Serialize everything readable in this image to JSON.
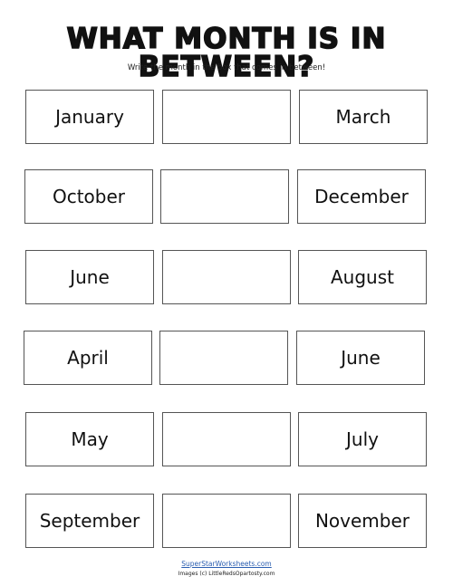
{
  "header": {
    "title": "WHAT MONTH IS IN BETWEEN?",
    "instructions": "Write the month in the box that comes in between!"
  },
  "rows": [
    {
      "before": "January",
      "answer": "",
      "after": "March"
    },
    {
      "before": "October",
      "answer": "",
      "after": "December"
    },
    {
      "before": "June",
      "answer": "",
      "after": "August"
    },
    {
      "before": "April",
      "answer": "",
      "after": "June"
    },
    {
      "before": "May",
      "answer": "",
      "after": "July"
    },
    {
      "before": "September",
      "answer": "",
      "after": "November"
    }
  ],
  "footer": {
    "site_link": "SuperStarWorksheets.com",
    "credit": "Images (c) LittleRedsOpartosty.com"
  },
  "colors": {
    "box_border": "#555555",
    "link": "#2a5db0"
  }
}
